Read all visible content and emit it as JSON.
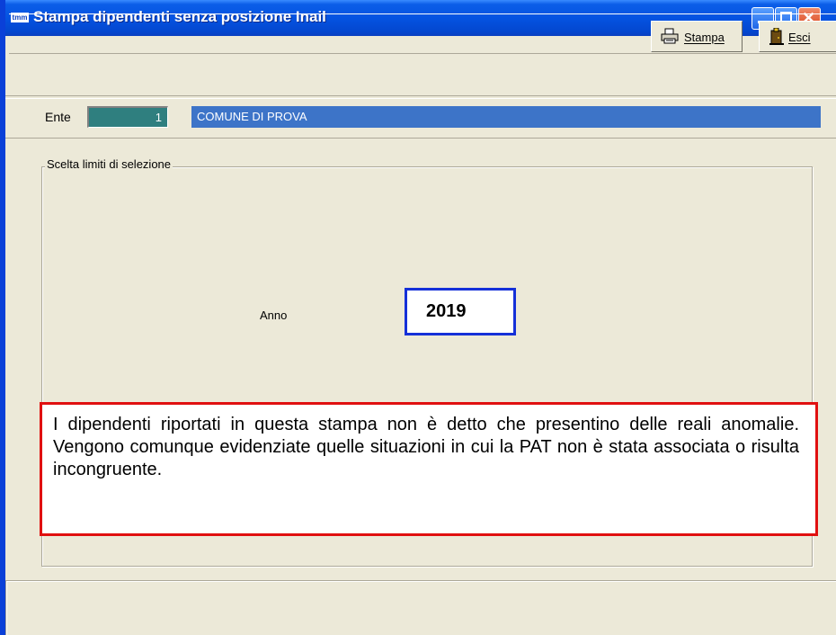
{
  "window": {
    "title": "Stampa dipendenti senza posizione Inail",
    "app_icon_text": "tmm"
  },
  "toolbar": {
    "print_label": "Stampa",
    "exit_label": "Esci",
    "print_icon": "printer-icon",
    "exit_icon": "door-exit-icon"
  },
  "ente": {
    "label": "Ente",
    "code": "1",
    "name": "COMUNE DI PROVA"
  },
  "selection": {
    "group_title": "Scelta limiti di selezione",
    "year_label": "Anno",
    "year_value": "2019"
  },
  "note": {
    "text": "I dipendenti riportati in questa stampa non è detto che presentino delle reali anomalie. Vengono comunque evidenziate quelle situazioni in cui la PAT non è stata associata o risulta incongruente."
  },
  "colors": {
    "title_bar": "#0553e1",
    "window_bg": "#ece9d8",
    "ente_code_bg": "#2f7f7f",
    "ente_name_bg": "#3d74c8",
    "year_border": "#1530d8",
    "note_border": "#e01010"
  }
}
